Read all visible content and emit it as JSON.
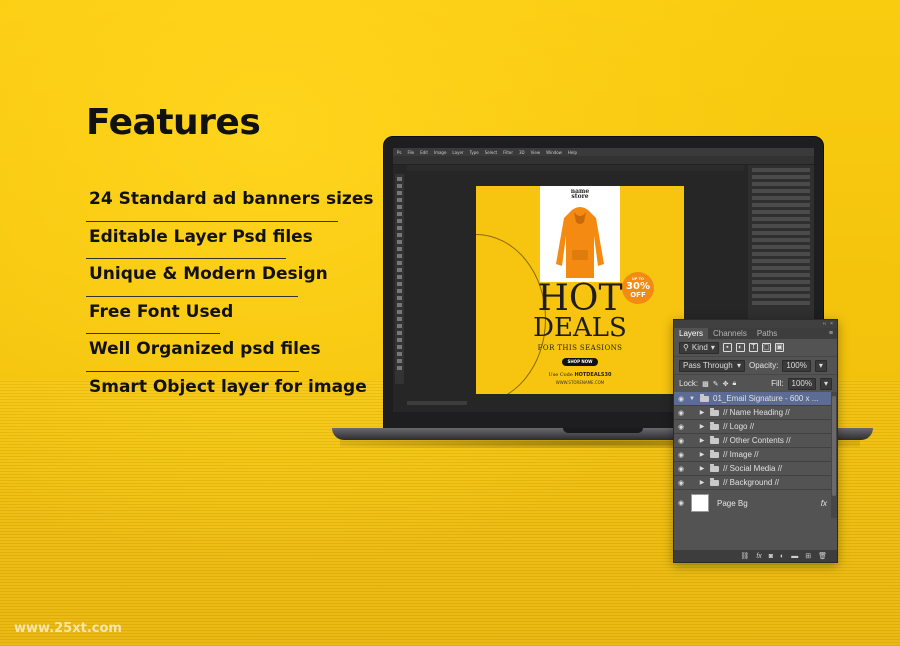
{
  "page": {
    "heading": "Features",
    "watermark": "www.25xt.com"
  },
  "features": [
    "24 Standard ad banners sizes",
    "Editable Layer Psd files",
    "Unique & Modern Design",
    "Free Font Used",
    "Well Organized psd files",
    "Smart Object layer for image"
  ],
  "colors": {
    "background": "#f7c712",
    "badge": "#f28a13",
    "selected_layer": "#5d6c94"
  },
  "artboard": {
    "brand_line1": "name",
    "brand_line2": "store",
    "headline1": "HOT",
    "headline2": "DEALS",
    "subhead": "FOR THIS SEASIONS",
    "button": "SHOP NOW",
    "code_prefix": "Use Code",
    "code": "HOTDEALS30",
    "website": "WWW.STORENAME.COM",
    "badge_upto": "UP TO",
    "badge_percent": "30%",
    "badge_off": "OFF"
  },
  "layers_panel": {
    "tabs": [
      "Layers",
      "Channels",
      "Paths"
    ],
    "active_tab": "Layers",
    "filter_label": "Kind",
    "blend_mode": "Pass Through",
    "opacity_label": "Opacity:",
    "opacity_value": "100%",
    "lock_label": "Lock:",
    "fill_label": "Fill:",
    "fill_value": "100%",
    "group_layer": "01_Email Signature - 600 x ...",
    "sublayers": [
      "// Name Heading //",
      "// Logo //",
      "// Other Contents //",
      "// Image //",
      "// Social Media //",
      "// Background //"
    ],
    "bg_layer": "Page Bg",
    "fx": "fx"
  },
  "icons": [
    "eye-icon",
    "folder-icon",
    "expand-arrow-icon",
    "link-icon",
    "fx-icon",
    "mask-icon",
    "adjustment-icon",
    "new-group-icon",
    "new-layer-icon",
    "trash-icon"
  ]
}
